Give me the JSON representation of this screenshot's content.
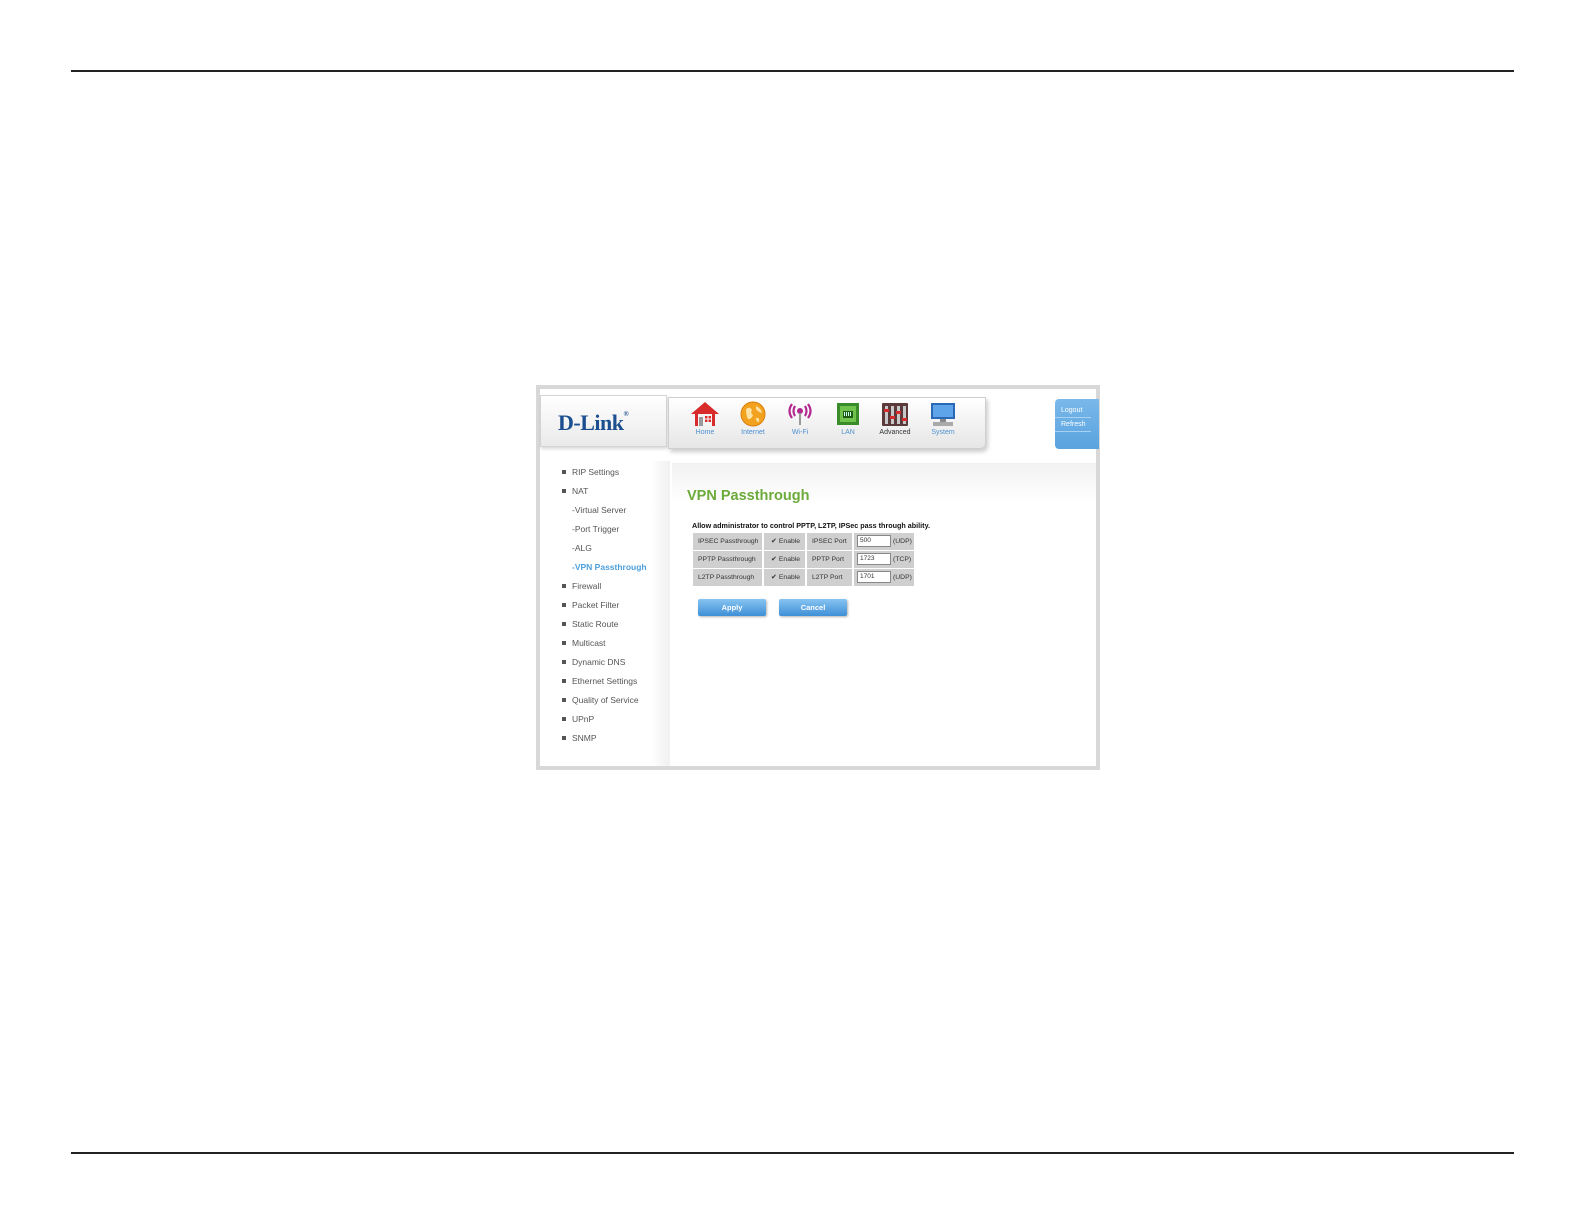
{
  "brand": {
    "logo_text": "D-Link",
    "logo_mark": "®"
  },
  "nav": {
    "items": [
      {
        "label": "Home",
        "icon": "home-icon"
      },
      {
        "label": "Internet",
        "icon": "globe-icon"
      },
      {
        "label": "Wi-Fi",
        "icon": "wifi-icon"
      },
      {
        "label": "LAN",
        "icon": "lan-icon"
      },
      {
        "label": "Advanced",
        "icon": "advanced-icon",
        "active": true
      },
      {
        "label": "System",
        "icon": "system-icon"
      }
    ]
  },
  "session": {
    "logout": "Logout",
    "refresh": "Refresh"
  },
  "sidebar": {
    "items": [
      {
        "label": "RIP Settings"
      },
      {
        "label": "NAT"
      },
      {
        "label": "-Virtual Server"
      },
      {
        "label": "-Port Trigger"
      },
      {
        "label": "-ALG"
      },
      {
        "label": "-VPN Passthrough"
      },
      {
        "label": "Firewall"
      },
      {
        "label": "Packet Filter"
      },
      {
        "label": "Static Route"
      },
      {
        "label": "Multicast"
      },
      {
        "label": "Dynamic DNS"
      },
      {
        "label": "Ethernet Settings"
      },
      {
        "label": "Quality of Service"
      },
      {
        "label": "UPnP"
      },
      {
        "label": "SNMP"
      }
    ]
  },
  "main": {
    "title": "VPN Passthrough",
    "description": "Allow administrator to control PPTP, L2TP, IPSec pass through ability.",
    "rows": [
      {
        "name": "IPSEC Passthrough",
        "enable_label": "Enable",
        "checked": true,
        "port_label": "IPSEC Port",
        "port_value": "500",
        "protocol": "(UDP)"
      },
      {
        "name": "PPTP Passthrough",
        "enable_label": "Enable",
        "checked": true,
        "port_label": "PPTP Port",
        "port_value": "1723",
        "protocol": "(TCP)"
      },
      {
        "name": "L2TP Passthrough",
        "enable_label": "Enable",
        "checked": true,
        "port_label": "L2TP Port",
        "port_value": "1701",
        "protocol": "(UDP)"
      }
    ],
    "apply_label": "Apply",
    "cancel_label": "Cancel"
  },
  "colors": {
    "accent_green": "#6cab3a",
    "accent_blue": "#4d9fdc",
    "brand_blue": "#1c4f8f"
  }
}
